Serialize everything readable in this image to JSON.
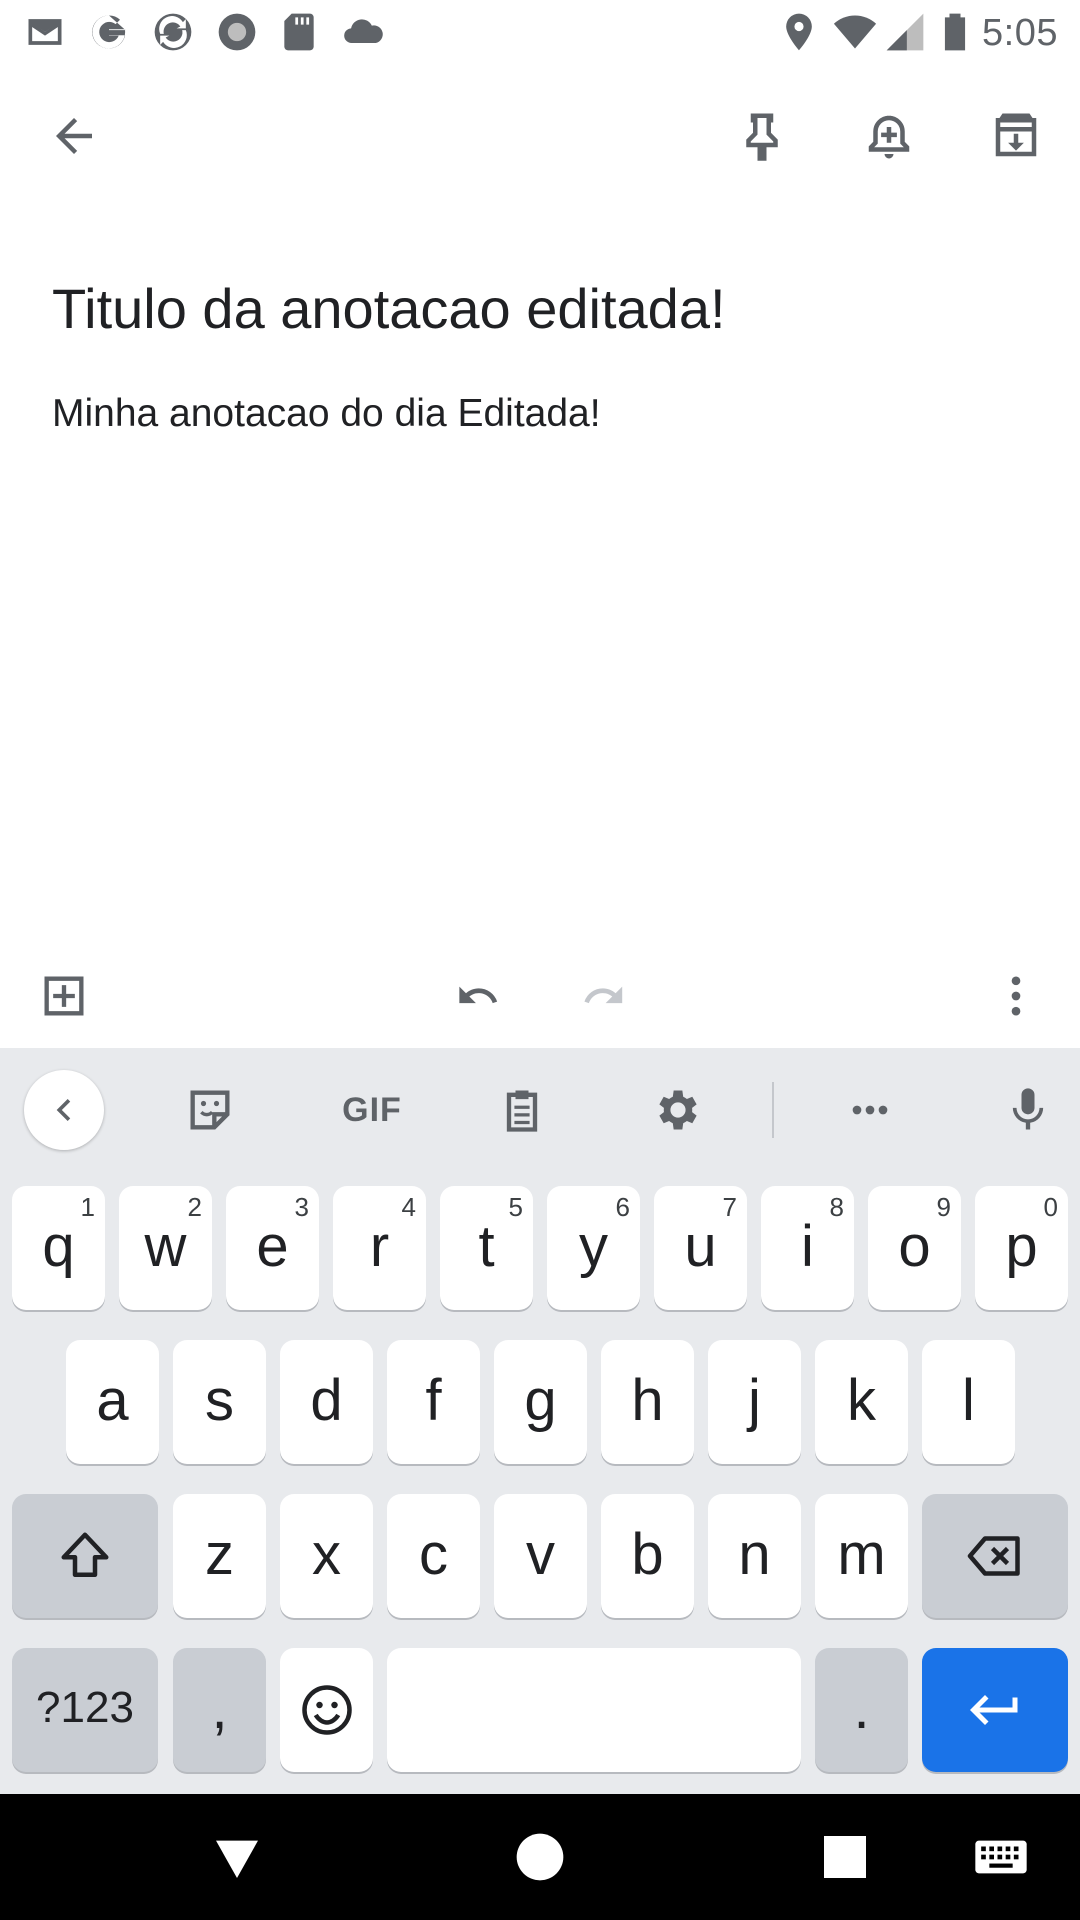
{
  "status_bar": {
    "time": "5:05",
    "left_icons": [
      "gmail-icon",
      "google-icon",
      "sync-app-icon",
      "record-icon",
      "sd-card-icon",
      "cloud-icon"
    ],
    "right_icons": [
      "location-icon",
      "wifi-icon",
      "signal-icon",
      "battery-icon"
    ]
  },
  "app_bar": {
    "actions": [
      "back-arrow-icon",
      "pin-icon",
      "reminder-bell-icon",
      "archive-icon"
    ]
  },
  "note": {
    "title": "Titulo da anotacao editada!",
    "body": "Minha anotacao do dia Editada!"
  },
  "note_toolbar": {
    "actions": [
      "add-box-icon",
      "undo-icon",
      "redo-icon",
      "more-vert-icon"
    ]
  },
  "keyboard": {
    "suggestion_strip": {
      "gif_label": "GIF",
      "actions": [
        "collapse-icon",
        "sticker-icon",
        "gif",
        "clipboard-icon",
        "settings-icon",
        "more-icon",
        "mic-icon"
      ]
    },
    "row1": [
      {
        "letter": "q",
        "hint": "1"
      },
      {
        "letter": "w",
        "hint": "2"
      },
      {
        "letter": "e",
        "hint": "3"
      },
      {
        "letter": "r",
        "hint": "4"
      },
      {
        "letter": "t",
        "hint": "5"
      },
      {
        "letter": "y",
        "hint": "6"
      },
      {
        "letter": "u",
        "hint": "7"
      },
      {
        "letter": "i",
        "hint": "8"
      },
      {
        "letter": "o",
        "hint": "9"
      },
      {
        "letter": "p",
        "hint": "0"
      }
    ],
    "row2": [
      "a",
      "s",
      "d",
      "f",
      "g",
      "h",
      "j",
      "k",
      "l"
    ],
    "row3": [
      "z",
      "x",
      "c",
      "v",
      "b",
      "n",
      "m"
    ],
    "row4": {
      "symbols_label": "?123",
      "comma": ",",
      "period": "."
    },
    "accent_color": "#1a73e8"
  },
  "nav_bar": {
    "buttons": [
      "back-triangle-icon",
      "home-circle-icon",
      "recents-square-icon",
      "keyboard-switch-icon"
    ]
  }
}
